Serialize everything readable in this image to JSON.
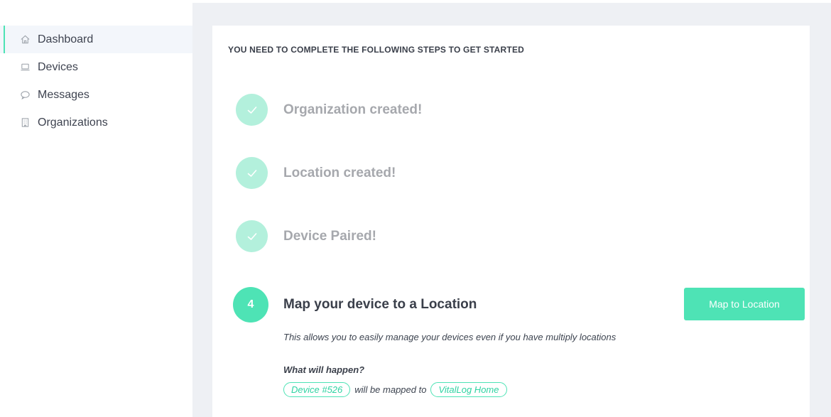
{
  "sidebar": {
    "items": [
      {
        "label": "Dashboard",
        "icon": "home-icon",
        "active": true
      },
      {
        "label": "Devices",
        "icon": "laptop-icon",
        "active": false
      },
      {
        "label": "Messages",
        "icon": "chat-bubble-icon",
        "active": false
      },
      {
        "label": "Organizations",
        "icon": "building-icon",
        "active": false
      }
    ]
  },
  "main": {
    "heading": "YOU NEED TO COMPLETE THE FOLLOWING STEPS TO GET STARTED",
    "completed_steps": [
      {
        "title": "Organization created!"
      },
      {
        "title": "Location created!"
      },
      {
        "title": "Device Paired!"
      }
    ],
    "current_step": {
      "number": "4",
      "title": "Map your device to a Location",
      "button_label": "Map to Location",
      "description": "This allows you to easily manage your devices even if you have multiply locations",
      "what_label": "What will happen?",
      "device": "Device #526",
      "connector": "will be mapped to",
      "location": "VitalLog Home"
    }
  },
  "colors": {
    "accent": "#4ee3b5",
    "accent_light": "#b3f0dc",
    "muted_text": "#a6a8ad"
  }
}
